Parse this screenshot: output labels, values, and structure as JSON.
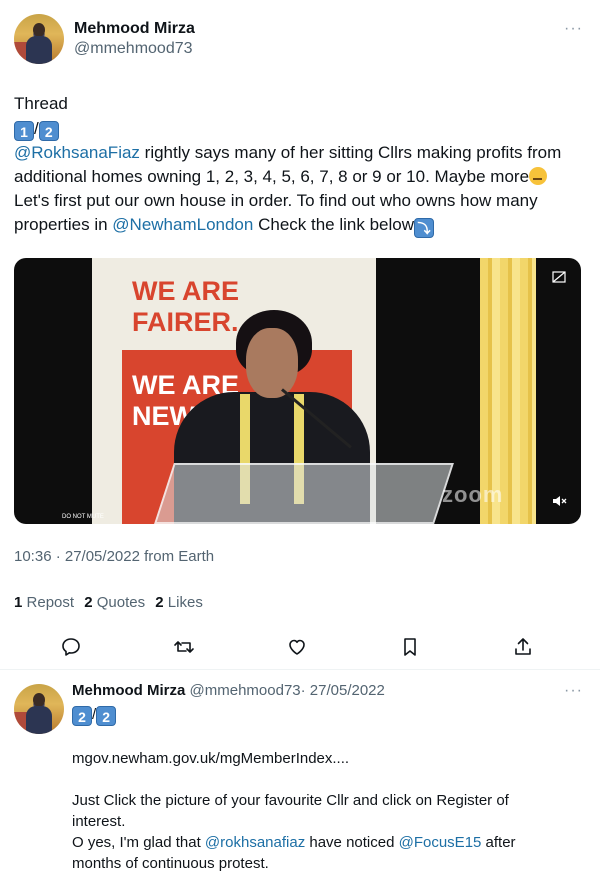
{
  "tweet": {
    "author_name": "Mehmood Mirza",
    "author_handle": "@mmehmood73",
    "more": "···",
    "line_thread": "Thread",
    "counter_1": "1",
    "counter_sep": "/",
    "counter_2": "2",
    "mention_1": "@RokhsanaFiaz",
    "body_1": " rightly says many of her sitting Cllrs making profits from additional homes owning 1, 2, 3, 4, 5, 6, 7, 8 or 9 or 10. Maybe more",
    "body_2": " Let's first put our own house in order. To find out who owns how many properties in ",
    "mention_2": "@NewhamLondon",
    "body_3": " Check the link below",
    "timestamp": "10:36 · 27/05/2022 from Earth",
    "stats": {
      "reposts_count": "1",
      "reposts_label": "Repost",
      "quotes_count": "2",
      "quotes_label": "Quotes",
      "likes_count": "2",
      "likes_label": "Likes"
    }
  },
  "media": {
    "banner_line_1": "WE ARE",
    "banner_line_2": "FAIRER.",
    "banner_line_3": "WE ARE",
    "banner_line_4": "NEW",
    "watermark": "zoom",
    "corner_label": "DO NOT MUTE"
  },
  "actions": [
    "reply-icon",
    "repost-icon",
    "like-icon",
    "bookmark-icon",
    "share-icon"
  ],
  "reply": {
    "author_name": "Mehmood Mirza",
    "author_handle": "@mmehmood73",
    "date": "· 27/05/2022",
    "more": "···",
    "counter_1": "2",
    "counter_sep": "/",
    "counter_2": "2",
    "link": "mgov.newham.gov.uk/mgMemberIndex....",
    "para_1": "Just Click the picture of your favourite Cllr and click on Register of interest.",
    "para_2_start": "O yes, I'm glad that ",
    "mention_1": "@rokhsanafiaz",
    "para_2_mid": " have noticed ",
    "mention_2": "@FocusE15",
    "para_2_end": " after months of continuous protest."
  },
  "colors": {
    "link": "#1d6fa5",
    "secondary_text": "#536471",
    "banner_red": "#d8452e"
  }
}
